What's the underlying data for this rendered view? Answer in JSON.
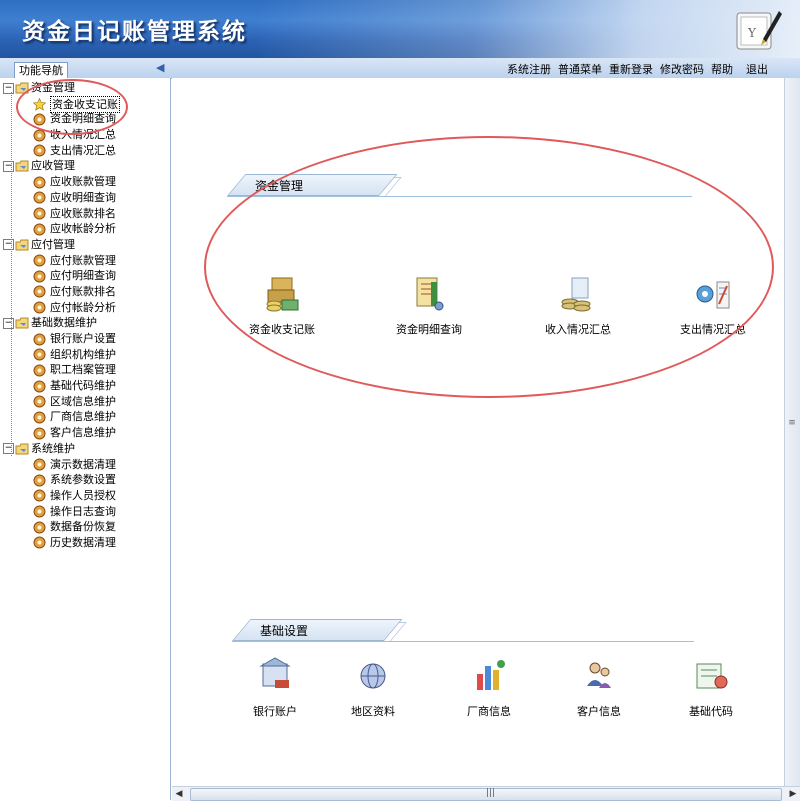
{
  "window": {
    "title": "资金日记账管理系统"
  },
  "toolbar": {
    "nav_tab_label": "功能导航",
    "menu": [
      "系统注册",
      "普通菜单",
      "重新登录",
      "修改密码",
      "帮助"
    ],
    "exit_label": "退出"
  },
  "sidebar": {
    "groups": [
      {
        "label": "资金管理",
        "items": [
          "资金收支记账",
          "资金明细查询",
          "收入情况汇总",
          "支出情况汇总"
        ]
      },
      {
        "label": "应收管理",
        "items": [
          "应收账款管理",
          "应收明细查询",
          "应收账款排名",
          "应收帐龄分析"
        ]
      },
      {
        "label": "应付管理",
        "items": [
          "应付账款管理",
          "应付明细查询",
          "应付账款排名",
          "应付帐龄分析"
        ]
      },
      {
        "label": "基础数据维护",
        "items": [
          "银行账户设置",
          "组织机构维护",
          "职工档案管理",
          "基础代码维护",
          "区域信息维护",
          "厂商信息维护",
          "客户信息维护"
        ]
      },
      {
        "label": "系统维护",
        "items": [
          "演示数据清理",
          "系统参数设置",
          "操作人员授权",
          "操作日志查询",
          "数据备份恢复",
          "历史数据清理"
        ]
      }
    ],
    "selected_item": "资金收支记账"
  },
  "main": {
    "sections": [
      {
        "title": "资金管理",
        "tiles": [
          "资金收支记账",
          "资金明细查询",
          "收入情况汇总",
          "支出情况汇总"
        ]
      },
      {
        "title": "基础设置",
        "tiles": [
          "银行账户",
          "地区资料",
          "厂商信息",
          "客户信息",
          "基础代码"
        ]
      }
    ]
  },
  "colors": {
    "titlebar": "#2f6fc2",
    "annotation": "#e05a5a",
    "accent_line": "#9fc1df"
  }
}
